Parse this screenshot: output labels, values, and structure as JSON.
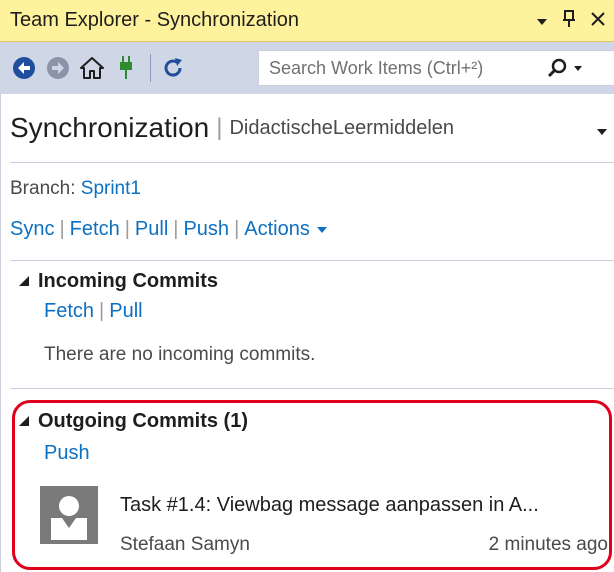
{
  "window": {
    "title": "Team Explorer - Synchronization"
  },
  "toolbar": {
    "search_placeholder": "Search Work Items (Ctrl+²)"
  },
  "header": {
    "page_title": "Synchronization",
    "separator": "|",
    "repository": "DidactischeLeermiddelen"
  },
  "branch": {
    "label": "Branch:",
    "name": "Sprint1"
  },
  "actions": {
    "sync": "Sync",
    "fetch": "Fetch",
    "pull": "Pull",
    "push": "Push",
    "actions": "Actions",
    "separator": "|"
  },
  "incoming": {
    "title": "Incoming Commits",
    "fetch": "Fetch",
    "pull": "Pull",
    "separator": "|",
    "empty_message": "There are no incoming commits."
  },
  "outgoing": {
    "title": "Outgoing Commits (1)",
    "push": "Push",
    "commits": [
      {
        "message": "Task #1.4: Viewbag message aanpassen in A...",
        "author": "Stefaan Samyn",
        "time": "2 minutes ago"
      }
    ]
  },
  "colors": {
    "title_bar": "#fff29d",
    "toolbar": "#cfd6e5",
    "link": "#0e70c0",
    "highlight": "#e0001b"
  },
  "icons": [
    "back-icon",
    "forward-icon",
    "home-icon",
    "connect-icon",
    "refresh-icon",
    "search-icon",
    "dropdown-icon",
    "pin-icon",
    "close-icon",
    "collapse-triangle-icon",
    "user-avatar-icon"
  ]
}
